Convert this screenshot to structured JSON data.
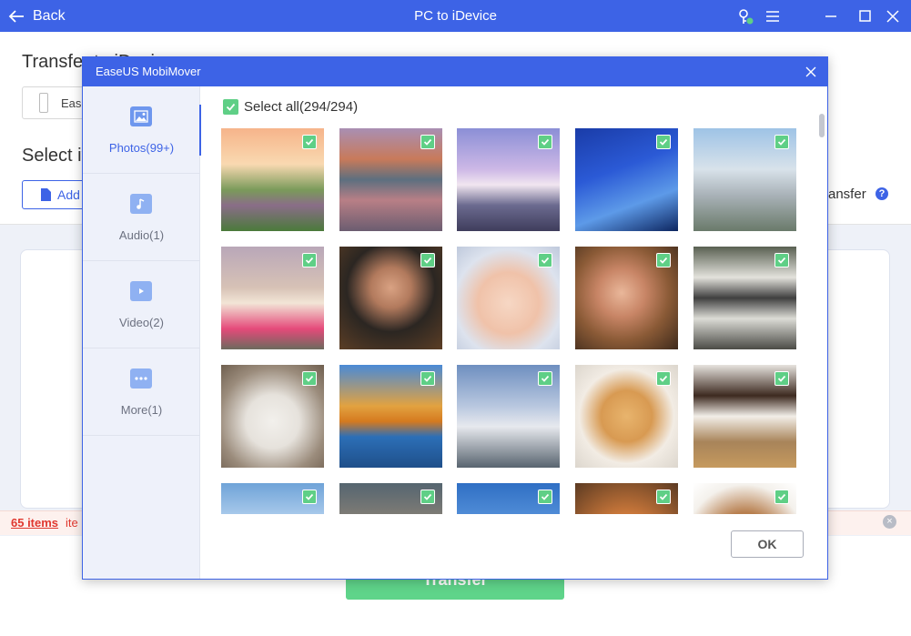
{
  "app": {
    "back_label": "Back",
    "title": "PC to iDevice"
  },
  "background": {
    "heading": "Transfer to iDevice",
    "device_name": "Ease",
    "select_heading": "Select it",
    "add_label": "Add",
    "transfer_label": "ransfer",
    "help_glyph": "?",
    "status_count": "65 items",
    "status_rest": "ite",
    "status_close_glyph": "×",
    "transfer_button": "Transfer"
  },
  "modal": {
    "title": "EaseUS MobiMover",
    "select_all_label": "Select all(294/294)",
    "ok_label": "OK",
    "categories": [
      {
        "label": "Photos(99+)",
        "icon": "image-icon"
      },
      {
        "label": "Audio(1)",
        "icon": "music-icon"
      },
      {
        "label": "Video(2)",
        "icon": "video-icon"
      },
      {
        "label": "More(1)",
        "icon": "more-icon"
      }
    ],
    "active_category": "Photos(99+)",
    "photos_checked": true,
    "photos": [
      "sunset-lake",
      "mountain-lake",
      "purple-sky",
      "glass-tower",
      "curved-building",
      "woman-dancing",
      "man-portrait",
      "surprised-baby",
      "woman-portrait",
      "village-rooftops",
      "cat-lying",
      "autumn-peak",
      "white-chapel",
      "puppy",
      "puppies-basket",
      "desert-hill",
      "canyon-rock",
      "blue-sky",
      "kitten",
      "dog-peek"
    ]
  },
  "colors": {
    "brand_blue": "#3d63e6",
    "check_green": "#5fcf86",
    "status_red": "#e0382f"
  }
}
